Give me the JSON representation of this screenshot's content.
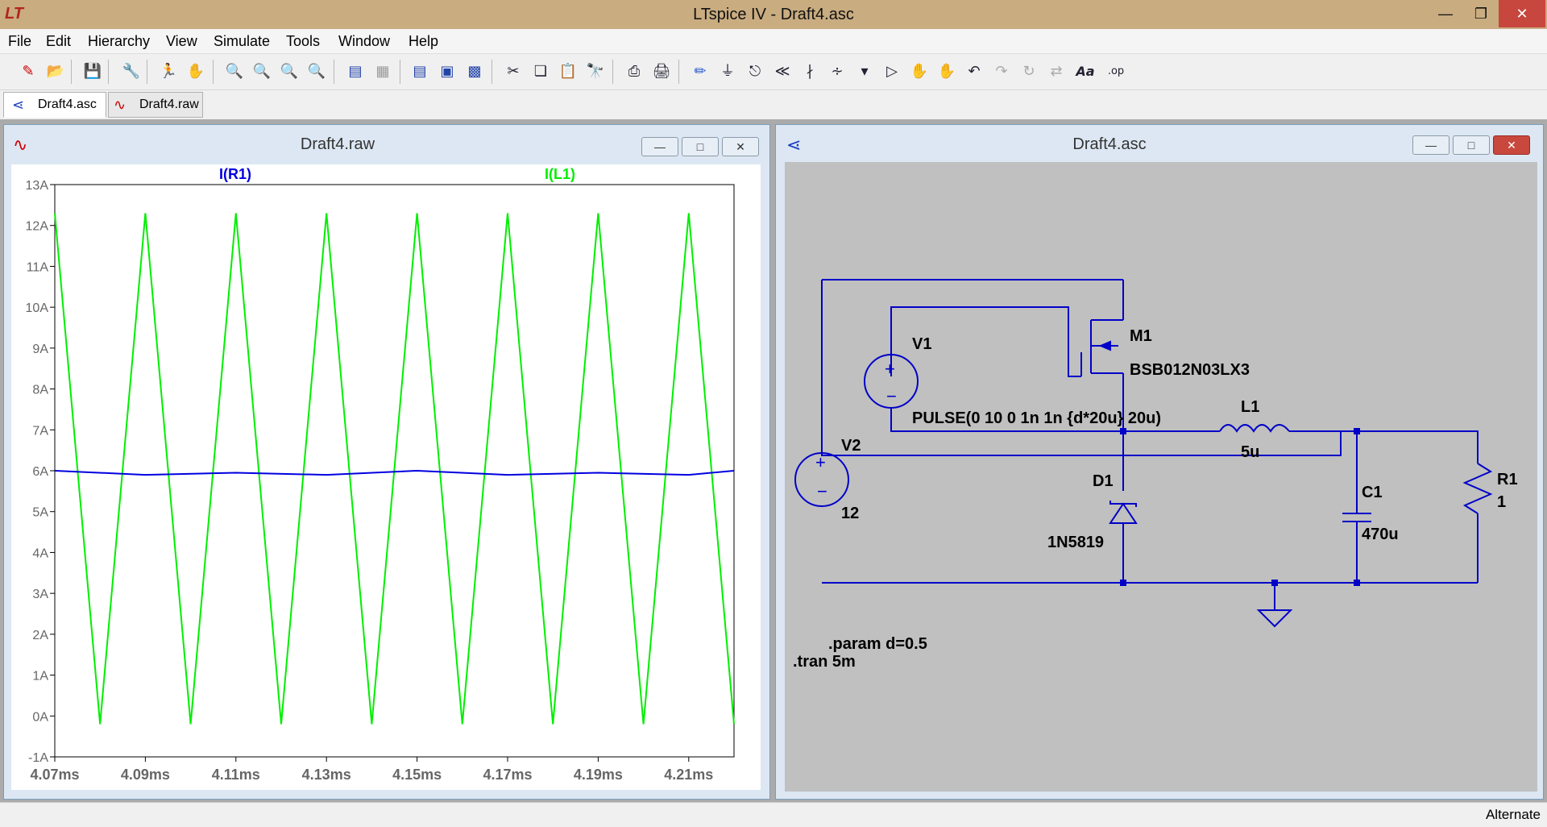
{
  "window": {
    "title": "LTspice IV - Draft4.asc"
  },
  "menu": [
    "File",
    "Edit",
    "Hierarchy",
    "View",
    "Simulate",
    "Tools",
    "Window",
    "Help"
  ],
  "tabs": [
    {
      "label": "Draft4.asc",
      "icon": "schematic-icon",
      "active": true
    },
    {
      "label": "Draft4.raw",
      "icon": "waveform-icon",
      "active": false
    }
  ],
  "plot_window": {
    "title": "Draft4.raw"
  },
  "schematic_window": {
    "title": "Draft4.asc"
  },
  "chart_data": {
    "type": "line",
    "series": [
      {
        "name": "I(R1)",
        "color": "#0000e0",
        "x_ms": [
          4.07,
          4.09,
          4.11,
          4.13,
          4.15,
          4.17,
          4.19,
          4.21,
          4.22
        ],
        "y_A": [
          6.0,
          5.9,
          5.95,
          5.9,
          6.0,
          5.9,
          5.95,
          5.9,
          6.0
        ]
      },
      {
        "name": "I(L1)",
        "color": "#00ee00",
        "x_ms": [
          4.07,
          4.08,
          4.09,
          4.1,
          4.11,
          4.12,
          4.13,
          4.14,
          4.15,
          4.16,
          4.17,
          4.18,
          4.19,
          4.2,
          4.21,
          4.22
        ],
        "y_A": [
          12.3,
          -0.2,
          12.3,
          -0.2,
          12.3,
          -0.2,
          12.3,
          -0.2,
          12.3,
          -0.2,
          12.3,
          -0.2,
          12.3,
          -0.2,
          12.3,
          -0.2
        ]
      }
    ],
    "xlim": [
      4.07,
      4.22
    ],
    "ylim": [
      -1,
      13
    ],
    "x_ticks": [
      "4.07ms",
      "4.09ms",
      "4.11ms",
      "4.13ms",
      "4.15ms",
      "4.17ms",
      "4.19ms",
      "4.21ms"
    ],
    "x_tick_values": [
      4.07,
      4.09,
      4.11,
      4.13,
      4.15,
      4.17,
      4.19,
      4.21
    ],
    "y_ticks": [
      "13A",
      "12A",
      "11A",
      "10A",
      "9A",
      "8A",
      "7A",
      "6A",
      "5A",
      "4A",
      "3A",
      "2A",
      "1A",
      "0A",
      "-1A"
    ],
    "y_tick_values": [
      13,
      12,
      11,
      10,
      9,
      8,
      7,
      6,
      5,
      4,
      3,
      2,
      1,
      0,
      -1
    ],
    "grid": false
  },
  "schematic": {
    "labels": {
      "v1": "V1",
      "v2": "V2",
      "v2_value": "12",
      "m1": "M1",
      "m1_model": "BSB012N03LX3",
      "pulse": "PULSE(0 10 0 1n 1n {d*20u} 20u)",
      "l1": "L1",
      "l1_value": "5u",
      "d1": "D1",
      "d1_model": "1N5819",
      "c1": "C1",
      "c1_value": "470u",
      "r1": "R1",
      "r1_value": "1",
      "param": ".param d=0.5",
      "tran": ".tran 5m"
    },
    "wire_color": "#0000c8",
    "background": "#c0c0c0"
  },
  "status": {
    "text": "Alternate"
  }
}
